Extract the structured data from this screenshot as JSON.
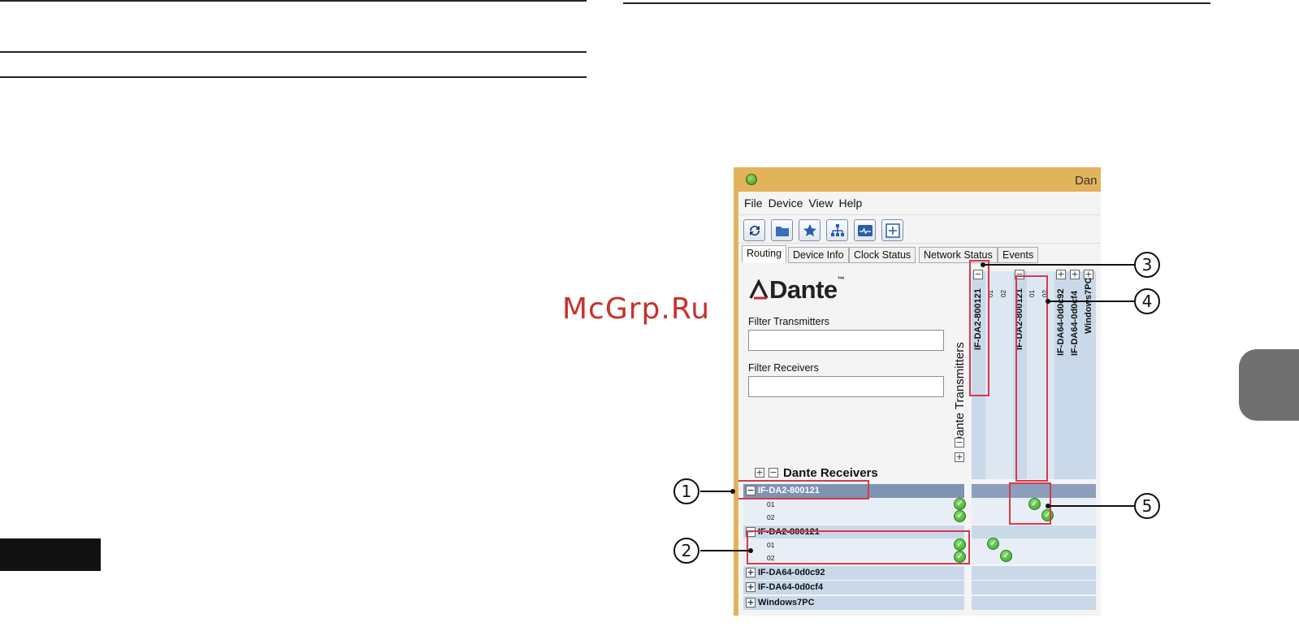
{
  "watermark": "McGrp.Ru",
  "window": {
    "title": "Dan",
    "menu": [
      "File",
      "Device",
      "View",
      "Help"
    ],
    "toolbar_icons": [
      "refresh-icon",
      "folder-icon",
      "star-icon",
      "network-icon",
      "monitor-icon",
      "add-icon"
    ],
    "tabs": [
      "Routing",
      "Device Info",
      "Clock Status",
      "Network Status",
      "Events"
    ],
    "active_tab": "Routing",
    "logo": "Dante",
    "filter_transmitters_label": "Filter Transmitters",
    "filter_receivers_label": "Filter Receivers",
    "transmitters_title": "Dante Transmitters",
    "receivers_title": "Dante Receivers"
  },
  "transmitters": [
    {
      "name": "IF-DA2-800121",
      "channels": [
        "01",
        "02"
      ]
    },
    {
      "name": "IF-DA2-800121",
      "channels": [
        "01",
        "02"
      ]
    },
    {
      "name": "IF-DA64-0d0c92"
    },
    {
      "name": "IF-DA64-0d0cf4"
    },
    {
      "name": "Windows7PC"
    }
  ],
  "receivers": [
    {
      "name": "IF-DA2-800121",
      "channels": [
        "01",
        "02"
      ]
    },
    {
      "name": "IF-DA2-800121",
      "channels": [
        "01",
        "02"
      ]
    },
    {
      "name": "IF-DA64-0d0c92"
    },
    {
      "name": "IF-DA64-0d0cf4"
    },
    {
      "name": "Windows7PC"
    }
  ],
  "callouts": [
    "1",
    "2",
    "3",
    "4",
    "5"
  ],
  "colors": {
    "titlebar": "#e3b35b",
    "highlight": "#d63a4a",
    "selected_row": "#7f93b3",
    "grid": "#c9d9ea"
  }
}
